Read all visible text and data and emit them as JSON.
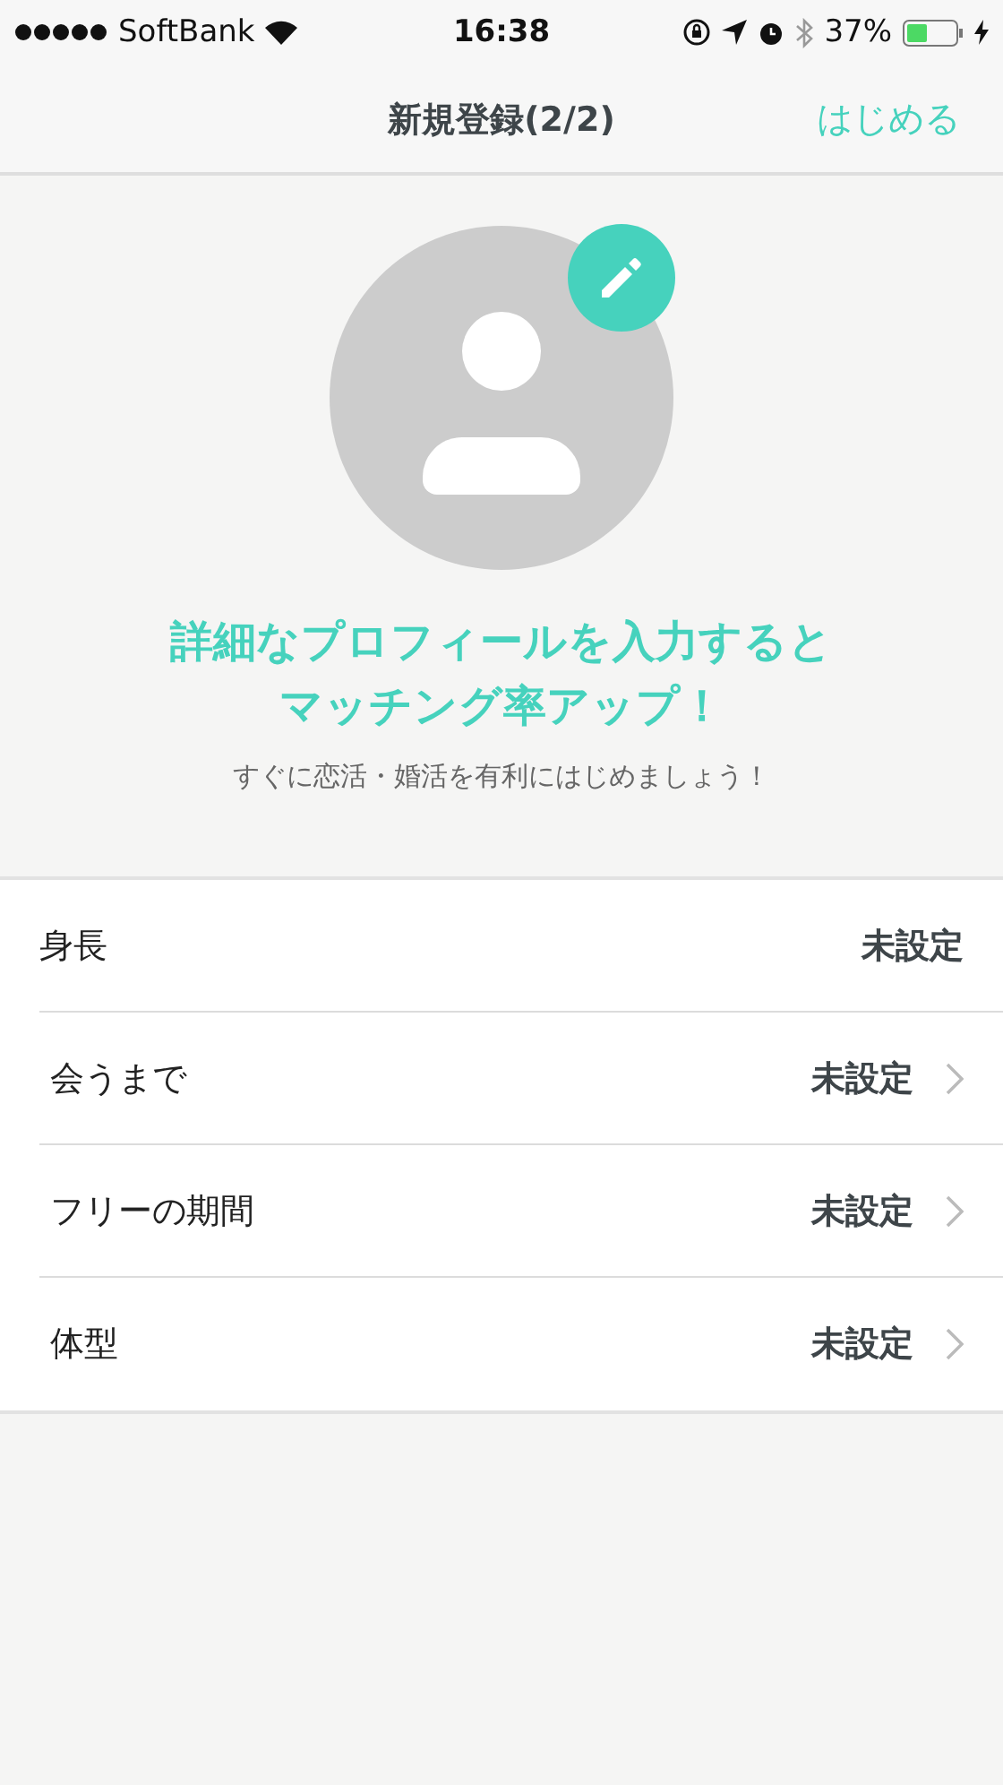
{
  "status_bar": {
    "carrier": "SoftBank",
    "time": "16:38",
    "battery": "37%"
  },
  "nav": {
    "title": "新規登録(2/2)",
    "action": "はじめる"
  },
  "profile": {
    "headline": [
      "詳細なプロフィールを入力すると",
      "マッチング率アップ！"
    ],
    "subtitle": "すぐに恋活・婚活を有利にはじめましょう！"
  },
  "rows": [
    {
      "label": "身長",
      "value": "未設定",
      "chevron": false
    },
    {
      "label": "会うまで",
      "value": "未設定",
      "chevron": true
    },
    {
      "label": "フリーの期間",
      "value": "未設定",
      "chevron": true
    },
    {
      "label": "体型",
      "value": "未設定",
      "chevron": true
    }
  ]
}
